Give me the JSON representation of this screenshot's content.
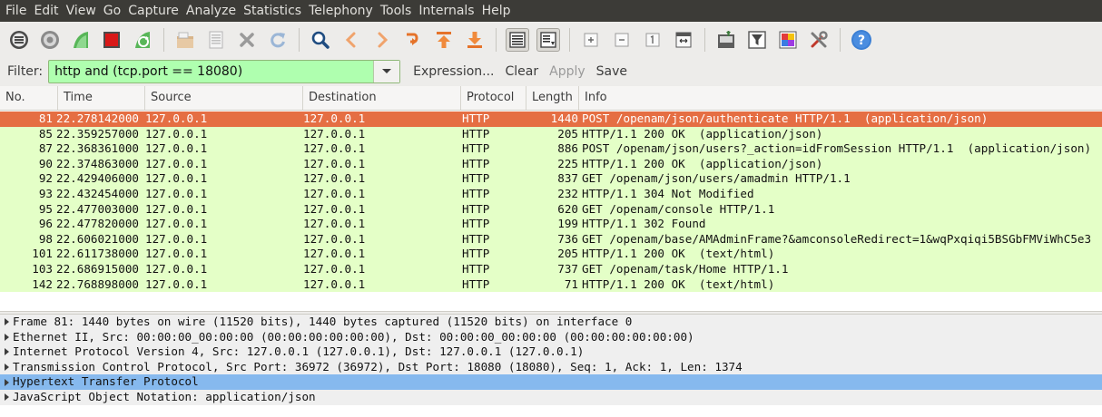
{
  "menubar": {
    "items": [
      "File",
      "Edit",
      "View",
      "Go",
      "Capture",
      "Analyze",
      "Statistics",
      "Telephony",
      "Tools",
      "Internals",
      "Help"
    ]
  },
  "toolbar": {
    "buttons": [
      "interface-list-icon",
      "capture-options-icon",
      "start-capture-icon",
      "stop-capture-icon",
      "restart-capture-icon",
      "open-file-icon",
      "save-file-icon",
      "close-file-icon",
      "reload-file-icon",
      "find-packet-icon",
      "go-back-icon",
      "go-forward-icon",
      "go-to-packet-icon",
      "go-first-icon",
      "go-last-icon",
      "colorize-icon",
      "auto-scroll-icon",
      "zoom-in-icon",
      "zoom-out-icon",
      "normal-size-icon",
      "resize-columns-icon",
      "capture-filters-icon",
      "display-filters-icon",
      "coloring-rules-icon",
      "preferences-icon",
      "help-icon"
    ]
  },
  "filter": {
    "label": "Filter:",
    "value": "http and (tcp.port == 18080)",
    "expression_label": "Expression...",
    "clear_label": "Clear",
    "apply_label": "Apply",
    "save_label": "Save",
    "box_color": "#afffaf"
  },
  "packet_list": {
    "columns": [
      "No.",
      "Time",
      "Source",
      "Destination",
      "Protocol",
      "Length",
      "Info"
    ],
    "rows": [
      {
        "no": "81",
        "time": "22.278142000",
        "src": "127.0.0.1",
        "dst": "127.0.0.1",
        "proto": "HTTP",
        "len": "1440",
        "info": "POST /openam/json/authenticate HTTP/1.1  (application/json)"
      },
      {
        "no": "85",
        "time": "22.359257000",
        "src": "127.0.0.1",
        "dst": "127.0.0.1",
        "proto": "HTTP",
        "len": "205",
        "info": "HTTP/1.1 200 OK  (application/json)"
      },
      {
        "no": "87",
        "time": "22.368361000",
        "src": "127.0.0.1",
        "dst": "127.0.0.1",
        "proto": "HTTP",
        "len": "886",
        "info": "POST /openam/json/users?_action=idFromSession HTTP/1.1  (application/json)"
      },
      {
        "no": "90",
        "time": "22.374863000",
        "src": "127.0.0.1",
        "dst": "127.0.0.1",
        "proto": "HTTP",
        "len": "225",
        "info": "HTTP/1.1 200 OK  (application/json)"
      },
      {
        "no": "92",
        "time": "22.429406000",
        "src": "127.0.0.1",
        "dst": "127.0.0.1",
        "proto": "HTTP",
        "len": "837",
        "info": "GET /openam/json/users/amadmin HTTP/1.1"
      },
      {
        "no": "93",
        "time": "22.432454000",
        "src": "127.0.0.1",
        "dst": "127.0.0.1",
        "proto": "HTTP",
        "len": "232",
        "info": "HTTP/1.1 304 Not Modified"
      },
      {
        "no": "95",
        "time": "22.477003000",
        "src": "127.0.0.1",
        "dst": "127.0.0.1",
        "proto": "HTTP",
        "len": "620",
        "info": "GET /openam/console HTTP/1.1"
      },
      {
        "no": "96",
        "time": "22.477820000",
        "src": "127.0.0.1",
        "dst": "127.0.0.1",
        "proto": "HTTP",
        "len": "199",
        "info": "HTTP/1.1 302 Found"
      },
      {
        "no": "98",
        "time": "22.606021000",
        "src": "127.0.0.1",
        "dst": "127.0.0.1",
        "proto": "HTTP",
        "len": "736",
        "info": "GET /openam/base/AMAdminFrame?&amconsoleRedirect=1&wqPxqiqi5BSGbFMViWhC5e3"
      },
      {
        "no": "101",
        "time": "22.611738000",
        "src": "127.0.0.1",
        "dst": "127.0.0.1",
        "proto": "HTTP",
        "len": "205",
        "info": "HTTP/1.1 200 OK  (text/html)"
      },
      {
        "no": "103",
        "time": "22.686915000",
        "src": "127.0.0.1",
        "dst": "127.0.0.1",
        "proto": "HTTP",
        "len": "737",
        "info": "GET /openam/task/Home HTTP/1.1"
      },
      {
        "no": "142",
        "time": "22.768898000",
        "src": "127.0.0.1",
        "dst": "127.0.0.1",
        "proto": "HTTP",
        "len": "71",
        "info": "HTTP/1.1 200 OK  (text/html)"
      }
    ],
    "selected_row_color": "#e56e43",
    "row_color": "#e4ffc7"
  },
  "details": {
    "rows": [
      "Frame 81: 1440 bytes on wire (11520 bits), 1440 bytes captured (11520 bits) on interface 0",
      "Ethernet II, Src: 00:00:00_00:00:00 (00:00:00:00:00:00), Dst: 00:00:00_00:00:00 (00:00:00:00:00:00)",
      "Internet Protocol Version 4, Src: 127.0.0.1 (127.0.0.1), Dst: 127.0.0.1 (127.0.0.1)",
      "Transmission Control Protocol, Src Port: 36972 (36972), Dst Port: 18080 (18080), Seq: 1, Ack: 1, Len: 1374",
      "Hypertext Transfer Protocol",
      "JavaScript Object Notation: application/json"
    ],
    "selected_color": "#86b9ee"
  }
}
